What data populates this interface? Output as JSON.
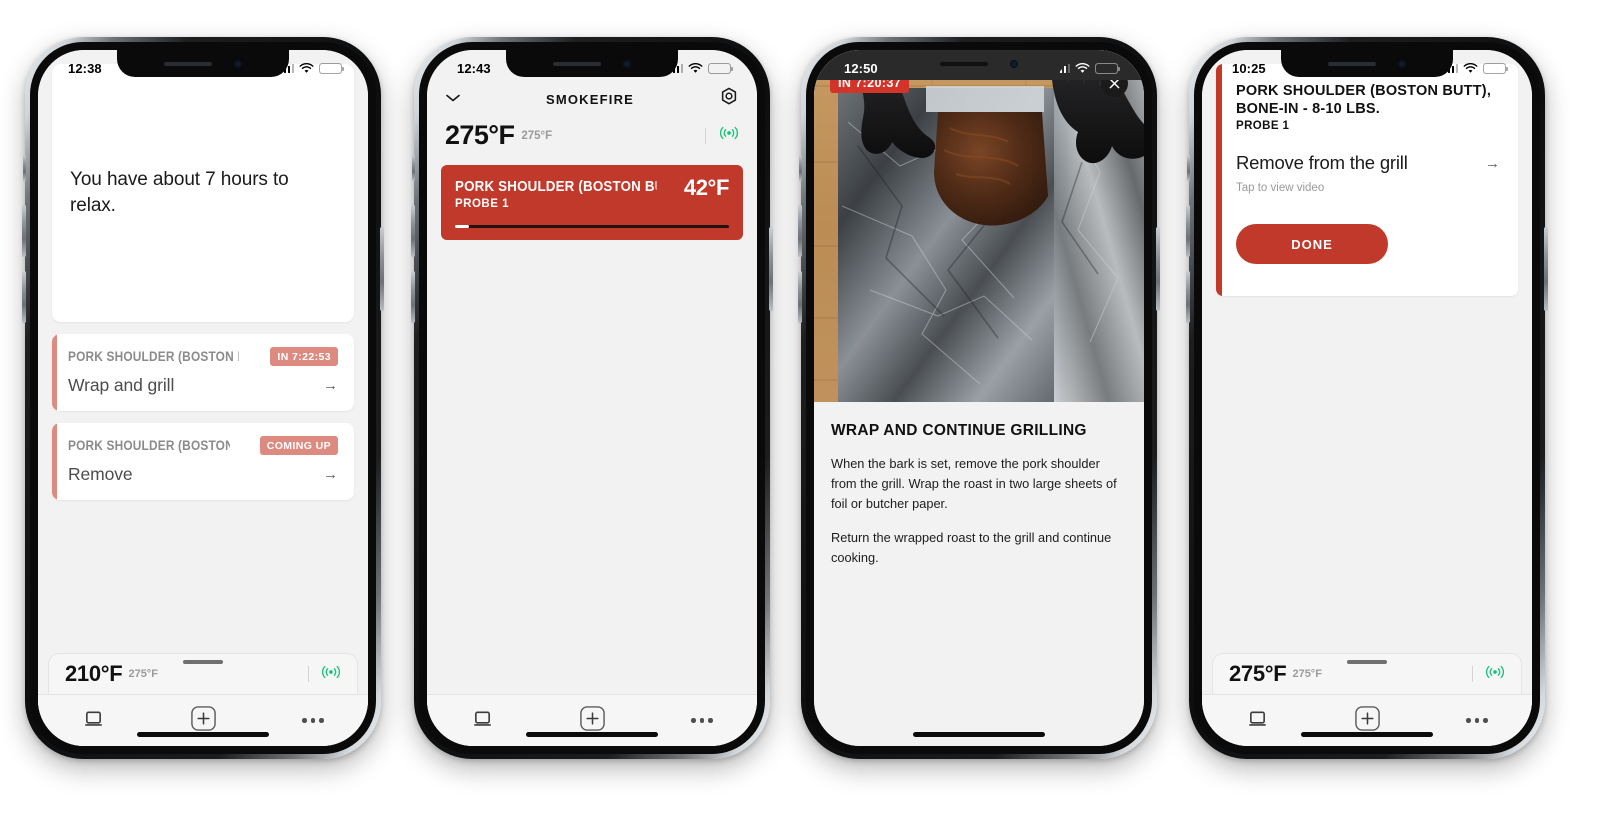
{
  "meta": {
    "accent_red": "#c0392b",
    "accent_red_soft": "#dd8b80",
    "accent_green": "#17c37b",
    "app_bg": "#f2f2f2",
    "battery_yellow": "#f7c52a"
  },
  "phones": [
    {
      "id": "phone-home",
      "status": {
        "time": "12:38",
        "signal": "cellular-icon",
        "wifi": "wifi-icon",
        "battery": "battery-icon",
        "battery_level": 38
      },
      "hero": {
        "text": "You have about 7 hours to relax."
      },
      "tasks": [
        {
          "title": "PORK SHOULDER (BOSTON BUT…",
          "badge": "IN 7:22:53",
          "action": "Wrap and grill",
          "arrow": "→"
        },
        {
          "title": "PORK SHOULDER (BOSTON BU…",
          "badge": "COMING UP",
          "action": "Remove",
          "arrow": "→"
        }
      ],
      "temp_bar": {
        "current": "210°F",
        "target": "275°F",
        "cast": "cast-connected-icon"
      },
      "tabbar": {
        "items": [
          "grill-icon",
          "add-icon",
          "more-icon"
        ]
      }
    },
    {
      "id": "phone-grill",
      "status": {
        "time": "12:43",
        "battery_level": 38
      },
      "nav": {
        "back": "chevron-down-icon",
        "title": "SMOKEFIRE",
        "settings": "gear-icon"
      },
      "grill": {
        "current": "275°F",
        "target": "275°F",
        "cast": "cast-connected-icon"
      },
      "probe": {
        "name": "PORK SHOULDER (BOSTON BUTT), BO…",
        "sub": "PROBE 1",
        "temp": "42°F",
        "progress_percent": 5
      },
      "tabbar": {
        "items": [
          "grill-icon",
          "add-icon",
          "more-icon"
        ]
      }
    },
    {
      "id": "phone-video",
      "status": {
        "time": "12:50",
        "battery_level": 38
      },
      "video": {
        "timer_badge": "IN 7:20:37",
        "close": "close-icon"
      },
      "article": {
        "heading": "WRAP AND CONTINUE GRILLING",
        "paragraphs": [
          "When the bark is set, remove the pork shoulder from the grill. Wrap the roast in two large sheets of foil or butcher paper.",
          "Return the wrapped roast to the grill and continue cooking."
        ]
      }
    },
    {
      "id": "phone-done",
      "status": {
        "time": "10:25",
        "battery_level": 85
      },
      "card": {
        "title": "PORK SHOULDER (BOSTON BUTT), BONE-IN - 8-10 LBS.",
        "probe": "PROBE 1",
        "action": "Remove from the grill",
        "arrow": "→",
        "hint": "Tap to view video",
        "button": "DONE"
      },
      "temp_bar": {
        "current": "275°F",
        "target": "275°F",
        "cast": "cast-connected-icon"
      },
      "tabbar": {
        "items": [
          "grill-icon",
          "add-icon",
          "more-icon"
        ]
      }
    }
  ]
}
